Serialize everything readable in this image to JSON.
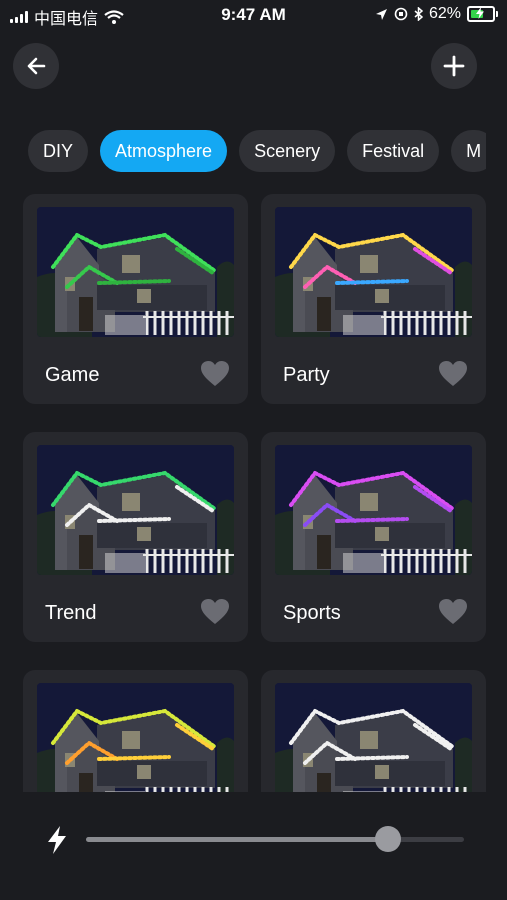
{
  "status_bar": {
    "carrier": "中国电信",
    "time": "9:47 AM",
    "battery": "62%",
    "battery_level": 0.62
  },
  "header": {
    "back_icon": "arrow-left-icon",
    "add_icon": "plus-icon"
  },
  "tabs": [
    {
      "label": "DIY",
      "active": false
    },
    {
      "label": "Atmosphere",
      "active": true
    },
    {
      "label": "Scenery",
      "active": false
    },
    {
      "label": "Festival",
      "active": false
    },
    {
      "label": "M",
      "active": false
    }
  ],
  "scenes": [
    {
      "label": "Game",
      "lights": [
        "#3fe05a",
        "#36c94c",
        "#2fb23f"
      ]
    },
    {
      "label": "Party",
      "lights": [
        "#ffd84a",
        "#ff5fb4",
        "#3aa8ff",
        "#e04ee0"
      ]
    },
    {
      "label": "Trend",
      "lights": [
        "#36d86c",
        "#f0f0f0",
        "#f0f0f0"
      ]
    },
    {
      "label": "Sports",
      "lights": [
        "#d94df2",
        "#8a4cf4",
        "#b44cf0"
      ]
    },
    {
      "label": "",
      "lights": [
        "#d6e83a",
        "#ff9f2e",
        "#ffcf3a"
      ]
    },
    {
      "label": "",
      "lights": [
        "#f0f0f0",
        "#f0f0f0",
        "#f0f0f0"
      ]
    }
  ],
  "brightness": {
    "icon": "lightning-bolt-icon",
    "level": 0.8
  },
  "colors": {
    "accent": "#14a8f3",
    "background": "#1b1c20",
    "card": "#27282d"
  }
}
